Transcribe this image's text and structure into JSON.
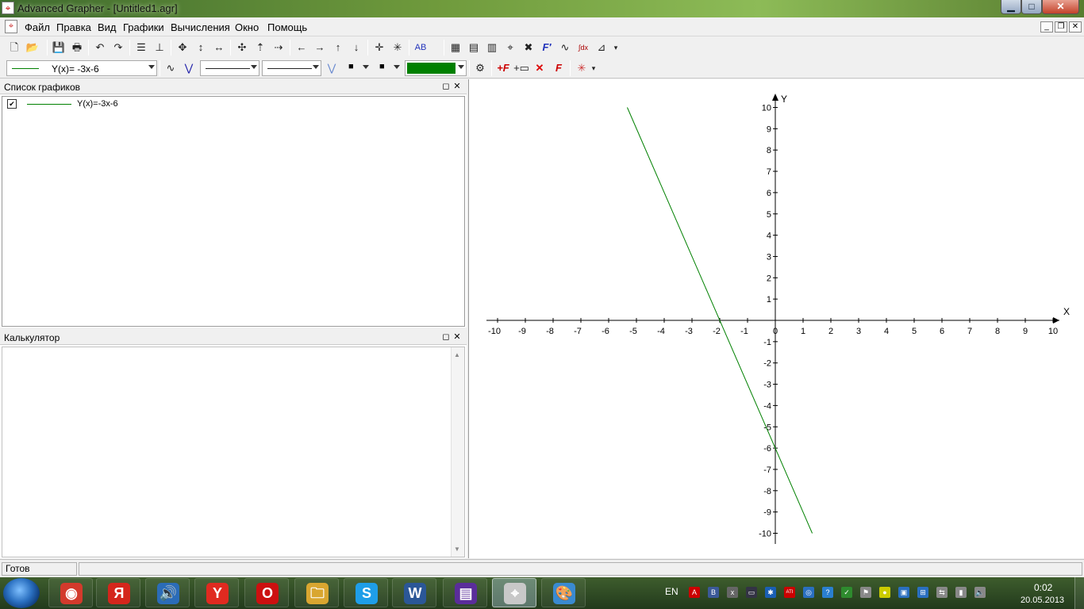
{
  "window": {
    "title": "Advanced Grapher - [Untitled1.agr]",
    "controls": {
      "minimize": "▁",
      "maximize": "□",
      "close": "✕"
    },
    "mdi_controls": {
      "minimize": "_",
      "restore": "❐",
      "close": "✕"
    }
  },
  "menu": {
    "items": [
      "Файл",
      "Правка",
      "Вид",
      "Графики",
      "Вычисления",
      "Окно",
      "Помощь"
    ]
  },
  "toolbar1": {
    "icons": [
      "new-file-icon",
      "open-file-icon",
      "save-icon",
      "print-icon",
      "undo-icon",
      "redo-icon",
      "graph-list-icon",
      "axes-icon",
      "move-icon",
      "move-vertical-icon",
      "move-horizontal-icon",
      "zoom-in-icon",
      "zoom-in-vertical-icon",
      "zoom-in-horizontal-icon",
      "arrow-left-icon",
      "arrow-right-icon",
      "arrow-up-icon",
      "arrow-down-icon",
      "center-icon",
      "zoom-fit-icon",
      "labels-icon",
      "panel-icon",
      "calculator-icon",
      "table-icon",
      "trace-icon",
      "intersection-icon",
      "derivative-icon",
      "tangent-icon",
      "integral-icon",
      "statistics-icon"
    ],
    "glyphs": [
      "🗋",
      "📂",
      "💾",
      "🖶",
      "↶",
      "↷",
      "☰",
      "⊥",
      "✥",
      "↕",
      "↔",
      "✣",
      "⇡",
      "⇢",
      "←",
      "→",
      "↑",
      "↓",
      "✛",
      "✳",
      "AB",
      "▦",
      "▤",
      "▥",
      "⌖",
      "✖",
      "F′",
      "∿",
      "∫dx",
      "⊿"
    ]
  },
  "toolbar2": {
    "graph_selector": "Y(x)= -3x-6",
    "line_color": "#008000",
    "icons": [
      "curve-style-icon",
      "point-style-icon",
      "marker-icon",
      "fill-icon",
      "graph-properties-icon",
      "add-graph-icon",
      "add-table-icon",
      "delete-graph-icon",
      "edit-graph-icon",
      "tools-icon"
    ],
    "glyphs": [
      "∿",
      "⋁",
      "⋁",
      "■",
      "■",
      "⚙",
      "+F",
      "+▭",
      "✕",
      "F",
      "✳"
    ]
  },
  "graph_list": {
    "title": "Список графиков",
    "panel_buttons": {
      "float": "◻",
      "close": "✕"
    },
    "items": [
      {
        "checked": "✔",
        "label": "Y(x)=-3x-6",
        "color": "#008000"
      }
    ]
  },
  "calculator": {
    "title": "Калькулятор",
    "panel_buttons": {
      "float": "◻",
      "close": "✕"
    }
  },
  "chart_data": {
    "type": "line",
    "title": "",
    "xlabel": "X",
    "ylabel": "Y",
    "xlim": [
      -10,
      10
    ],
    "ylim": [
      -10,
      10
    ],
    "x_ticks": [
      -10,
      -9,
      -8,
      -7,
      -6,
      -5,
      -4,
      -3,
      -2,
      -1,
      0,
      1,
      2,
      3,
      4,
      5,
      6,
      7,
      8,
      9,
      10
    ],
    "y_ticks": [
      10,
      9,
      8,
      7,
      6,
      5,
      4,
      3,
      2,
      1,
      -1,
      -2,
      -3,
      -4,
      -5,
      -6,
      -7,
      -8,
      -9,
      -10
    ],
    "series": [
      {
        "name": "Y(x)=-3x-6",
        "color": "#008000",
        "x": [
          -5.33,
          1.33
        ],
        "y": [
          10,
          -10
        ]
      }
    ],
    "grid": false
  },
  "status": {
    "text": "Готов"
  },
  "taskbar": {
    "apps": [
      {
        "name": "chrome-task",
        "glyph": "◉",
        "color": "#d33a2c"
      },
      {
        "name": "yandex-task",
        "glyph": "Я",
        "color": "#d4261c"
      },
      {
        "name": "audio-task",
        "glyph": "🔊",
        "color": "#2b6cb8"
      },
      {
        "name": "yandex-browser-task",
        "glyph": "Y",
        "color": "#e02a20"
      },
      {
        "name": "opera-task",
        "glyph": "O",
        "color": "#cc1010"
      },
      {
        "name": "explorer-task",
        "glyph": "🗀",
        "color": "#d9a630"
      },
      {
        "name": "skype-task",
        "glyph": "S",
        "color": "#1f9ee8"
      },
      {
        "name": "word-task",
        "glyph": "W",
        "color": "#2b5797"
      },
      {
        "name": "viewer-task",
        "glyph": "▤",
        "color": "#5a2d9a"
      },
      {
        "name": "grapher-task",
        "glyph": "⌖",
        "color": "#c8c8c8"
      },
      {
        "name": "paint-task",
        "glyph": "🎨",
        "color": "#3a8ad0"
      }
    ],
    "language": "EN",
    "tray_icons": [
      "adobe-icon",
      "vk-icon",
      "network-x-icon",
      "monitor-icon",
      "bluetooth-icon",
      "ati-icon",
      "update-icon",
      "help-icon",
      "security-icon",
      "flag-icon",
      "lightbulb-icon",
      "chat-icon",
      "network-icon",
      "usb-icon",
      "signal-icon",
      "volume-icon"
    ],
    "tray_glyphs": [
      "A",
      "B",
      "x",
      "▭",
      "✱",
      "ATI",
      "◎",
      "?",
      "✓",
      "⚑",
      "●",
      "▣",
      "⊞",
      "⇆",
      "▮",
      "🔈"
    ],
    "time": "0:02",
    "date": "20.05.2013"
  }
}
